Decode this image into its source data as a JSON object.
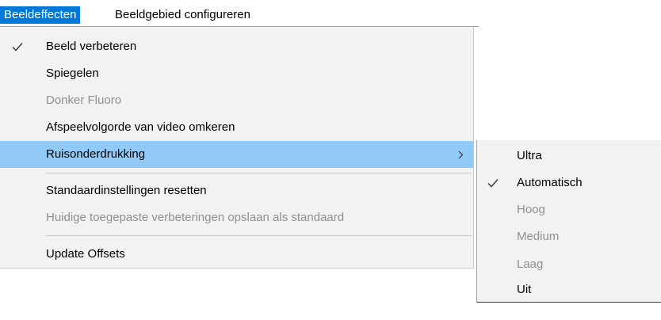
{
  "menubar": {
    "items": [
      {
        "label": "Beeldeffecten"
      },
      {
        "label": "Beeldgebied configureren"
      }
    ]
  },
  "menu": {
    "items": [
      {
        "label": "Beeld verbeteren",
        "checked": true,
        "enabled": true
      },
      {
        "label": "Spiegelen",
        "checked": false,
        "enabled": true
      },
      {
        "label": "Donker Fluoro",
        "checked": false,
        "enabled": false
      },
      {
        "label": "Afspeelvolgorde van video omkeren",
        "checked": false,
        "enabled": true
      },
      {
        "label": "Ruisonderdrukking",
        "checked": false,
        "enabled": true,
        "submenu": true,
        "highlighted": true
      },
      {
        "label": "Standaardinstellingen resetten",
        "checked": false,
        "enabled": true
      },
      {
        "label": "Huidige toegepaste verbeteringen opslaan als standaard",
        "checked": false,
        "enabled": false
      },
      {
        "label": "Update Offsets",
        "checked": false,
        "enabled": true
      }
    ]
  },
  "submenu": {
    "items": [
      {
        "label": "Ultra",
        "checked": false,
        "enabled": true
      },
      {
        "label": "Automatisch",
        "checked": true,
        "enabled": true
      },
      {
        "label": "Hoog",
        "checked": false,
        "enabled": false
      },
      {
        "label": "Medium",
        "checked": false,
        "enabled": false
      },
      {
        "label": "Laag",
        "checked": false,
        "enabled": false
      },
      {
        "label": "Uit",
        "checked": false,
        "enabled": true
      }
    ]
  },
  "colors": {
    "menubar_active_bg": "#0078d7",
    "highlight_bg": "#91c9f7",
    "menu_bg": "#f2f2f2",
    "disabled_text": "#8f8f8f"
  },
  "icons": {
    "check": "checkmark-icon",
    "submenu_arrow": "chevron-right-icon"
  }
}
